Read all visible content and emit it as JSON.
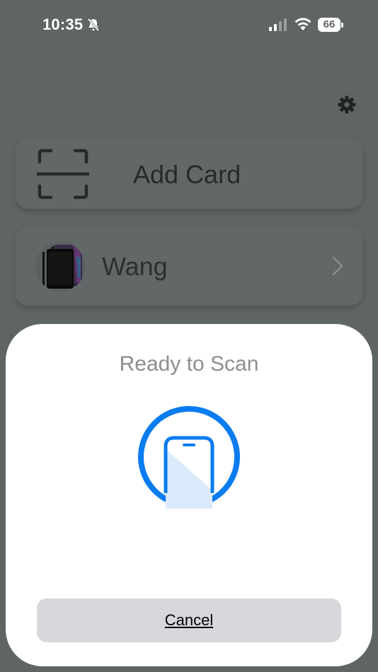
{
  "status_bar": {
    "time": "10:35",
    "battery": "66",
    "icons": [
      "bell-slash-icon",
      "cellular-signal-icon",
      "wifi-icon",
      "battery-icon"
    ]
  },
  "header": {
    "settings_icon": "gear-icon"
  },
  "add_card": {
    "label": "Add Card",
    "icon": "scan-frame-icon"
  },
  "cards": [
    {
      "label": "Wang",
      "icon": "card-thumbnail",
      "accessory": "chevron-right-icon"
    }
  ],
  "scan_sheet": {
    "title": "Ready to Scan",
    "icon": "phone-scan-icon",
    "accent": "#0a7cf0",
    "cancel_label": "Cancel"
  },
  "colors": {
    "background_dimmed": "#5f6464",
    "sheet": "#ffffff",
    "cancel_button": "#d7d7dc"
  }
}
